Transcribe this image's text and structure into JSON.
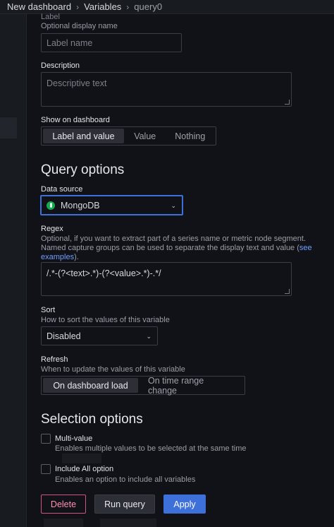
{
  "breadcrumb": {
    "items": [
      "New dashboard",
      "Variables",
      "query0"
    ],
    "separator": "›"
  },
  "label_field": {
    "label": "Label",
    "description": "Optional display name",
    "placeholder": "Label name"
  },
  "description_field": {
    "label": "Description",
    "placeholder": "Descriptive text"
  },
  "show_on_dashboard": {
    "label": "Show on dashboard",
    "options": [
      "Label and value",
      "Value",
      "Nothing"
    ],
    "selected": "Label and value"
  },
  "query_options": {
    "title": "Query options",
    "data_source": {
      "label": "Data source",
      "value": "MongoDB",
      "icon": "mongodb-leaf-icon"
    },
    "regex": {
      "label": "Regex",
      "description_line1": "Optional, if you want to extract part of a series name or metric node segment.",
      "description_line2": "Named capture groups can be used to separate the display text and value (",
      "link_text_1": "see",
      "link_text_2": "examples",
      "description_end": ").",
      "value": "/.*-(?<text>.*)-(?<value>.*)-.*/"
    },
    "sort": {
      "label": "Sort",
      "description": "How to sort the values of this variable",
      "value": "Disabled"
    },
    "refresh": {
      "label": "Refresh",
      "description": "When to update the values of this variable",
      "options": [
        "On dashboard load",
        "On time range change"
      ],
      "selected": "On dashboard load"
    }
  },
  "selection_options": {
    "title": "Selection options",
    "multi_value": {
      "label": "Multi-value",
      "description": "Enables multiple values to be selected at the same time",
      "checked": false
    },
    "include_all": {
      "label": "Include All option",
      "description": "Enables an option to include all variables",
      "checked": false
    }
  },
  "actions": {
    "delete_label": "Delete",
    "run_query_label": "Run query",
    "apply_label": "Apply"
  },
  "colors": {
    "background": "#111217",
    "accent": "#3d71d9",
    "danger": "#d1557f",
    "mongodb": "#13aa52"
  }
}
